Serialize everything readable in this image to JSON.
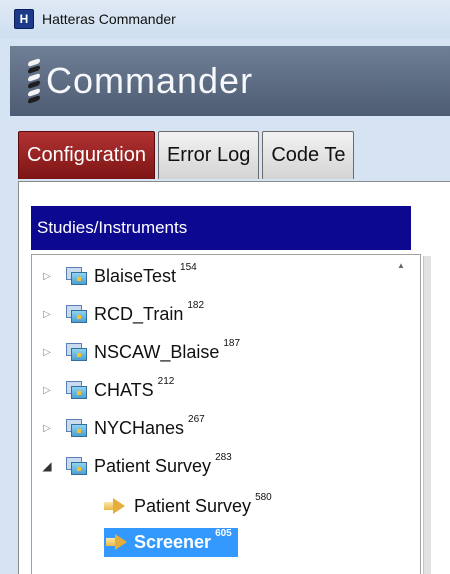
{
  "window": {
    "icon_letter": "H",
    "title": "Hatteras Commander"
  },
  "banner": {
    "title": "Commander"
  },
  "tabs": [
    {
      "label": "Configuration",
      "active": true
    },
    {
      "label": "Error Log",
      "active": false
    },
    {
      "label": "Code Te",
      "active": false
    }
  ],
  "panel": {
    "header": "Studies/Instruments"
  },
  "tree": {
    "items": [
      {
        "label": "BlaiseTest",
        "count": "154",
        "expander": "▷",
        "icon": "dataset-icon"
      },
      {
        "label": "RCD_Train",
        "count": "182",
        "expander": "▷",
        "icon": "dataset-icon"
      },
      {
        "label": "NSCAW_Blaise",
        "count": "187",
        "expander": "▷",
        "icon": "dataset-icon"
      },
      {
        "label": "CHATS",
        "count": "212",
        "expander": "▷",
        "icon": "dataset-icon"
      },
      {
        "label": "NYCHanes",
        "count": "267",
        "expander": "▷",
        "icon": "dataset-icon"
      },
      {
        "label": "Patient Survey",
        "count": "283",
        "expander": "◢",
        "icon": "dataset-icon"
      },
      {
        "label": "Patient Survey",
        "count": "580",
        "icon": "instrument-arrow-icon"
      },
      {
        "label": "Screener",
        "count": "605",
        "icon": "instrument-arrow-icon",
        "selected": true
      }
    ]
  },
  "colors": {
    "active_tab": "#9c2222",
    "section_header": "#0c0890",
    "selection": "#3399ff"
  }
}
